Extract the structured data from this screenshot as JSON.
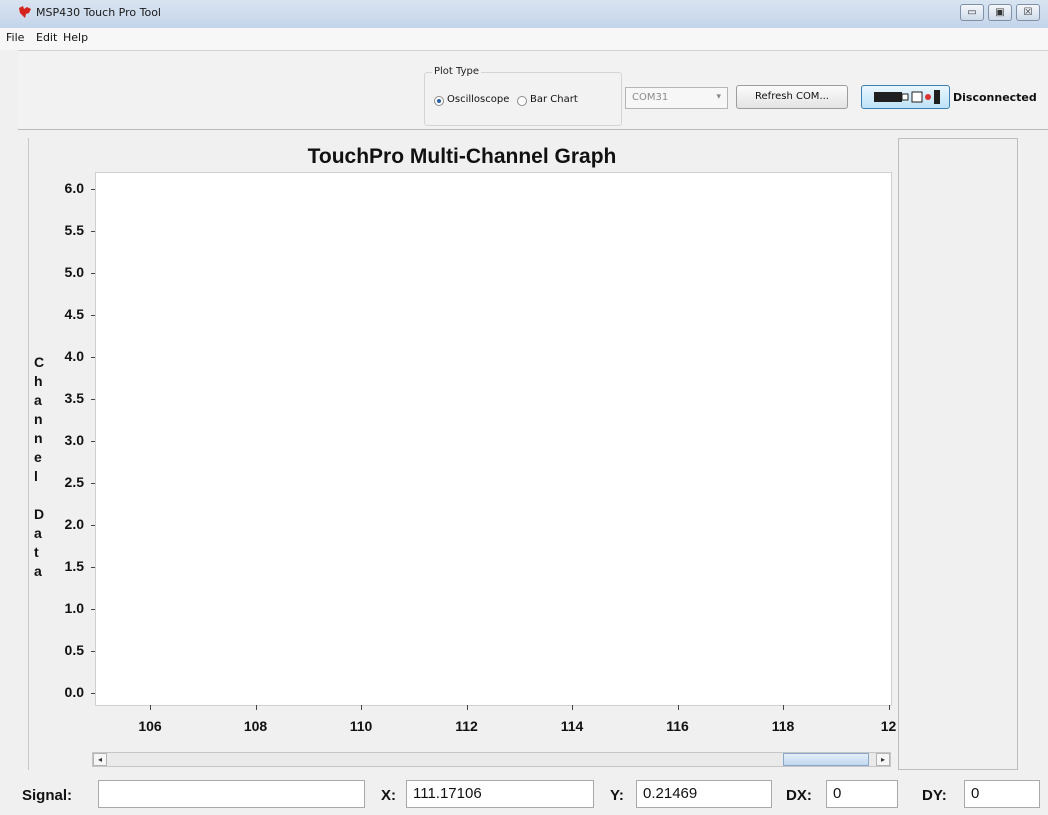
{
  "window": {
    "title": "MSP430 Touch Pro Tool",
    "controls": {
      "minimize": "▭",
      "maximize": "▣",
      "close": "☒"
    }
  },
  "menu": {
    "items": [
      {
        "label": "File"
      },
      {
        "label": "Edit"
      },
      {
        "label": "Help"
      }
    ]
  },
  "toolbar": {
    "plot_type_label": "Plot Type",
    "options": [
      {
        "label": "Oscilloscope",
        "selected": true
      },
      {
        "label": "Bar Chart",
        "selected": false
      }
    ],
    "com_port": {
      "value": "COM31"
    },
    "refresh_label": "Refresh COM...",
    "connection_icon": "usb-disconnected-icon",
    "status": "Disconnected"
  },
  "chart_data": {
    "type": "line",
    "title": "TouchPro Multi-Channel Graph",
    "ylabel": "Channel Data",
    "ylabel_chars": [
      "C",
      "h",
      "a",
      "n",
      "n",
      "e",
      "l",
      "",
      "D",
      "a",
      "t",
      "a"
    ],
    "yticks": [
      "6.0",
      "5.5",
      "5.0",
      "4.5",
      "4.0",
      "3.5",
      "3.0",
      "2.5",
      "2.0",
      "1.5",
      "1.0",
      "0.5",
      "0.0"
    ],
    "xticks": [
      "106",
      "108",
      "110",
      "112",
      "114",
      "116",
      "118",
      "12"
    ],
    "ylim": [
      0,
      6.0
    ],
    "series": [],
    "grid": false
  },
  "readouts": {
    "signal": {
      "label": "Signal:",
      "value": ""
    },
    "x": {
      "label": "X:",
      "value": "111.17106"
    },
    "y": {
      "label": "Y:",
      "value": "0.21469"
    },
    "dx": {
      "label": "DX:",
      "value": "0"
    },
    "dy": {
      "label": "DY:",
      "value": "0"
    }
  },
  "colors": {
    "accent": "#3c7fb1",
    "titlebar": "#c4d5ea"
  }
}
